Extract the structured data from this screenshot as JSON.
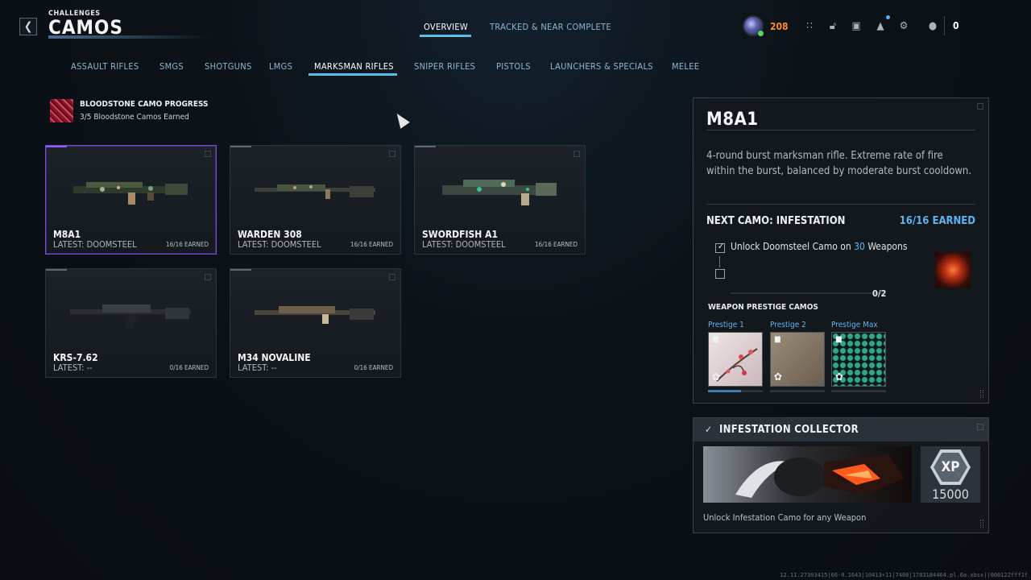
{
  "header": {
    "kicker": "CHALLENGES",
    "title": "CAMOS",
    "tabs": [
      {
        "label": "OVERVIEW",
        "active": true
      },
      {
        "label": "TRACKED & NEAR COMPLETE",
        "active": false
      }
    ],
    "status_count": "208",
    "currency": "0",
    "icons": [
      "back-icon",
      "grid-icon",
      "lock-icon",
      "camera-icon",
      "bell-icon",
      "gear-icon",
      "party-icon"
    ]
  },
  "categories": [
    {
      "label": "ASSAULT RIFLES"
    },
    {
      "label": "SMGS"
    },
    {
      "label": "SHOTGUNS"
    },
    {
      "label": "LMGS"
    },
    {
      "label": "MARKSMAN RIFLES",
      "active": true
    },
    {
      "label": "SNIPER RIFLES"
    },
    {
      "label": "PISTOLS"
    },
    {
      "label": "LAUNCHERS & SPECIALS"
    },
    {
      "label": "MELEE"
    }
  ],
  "progress": {
    "title": "BLOODSTONE CAMO PROGRESS",
    "subtitle": "3/5 Bloodstone Camos Earned"
  },
  "weapons": [
    {
      "name": "M8A1",
      "latest": "LATEST: DOOMSTEEL",
      "earned": "16/16 EARNED",
      "selected": true
    },
    {
      "name": "WARDEN 308",
      "latest": "LATEST: DOOMSTEEL",
      "earned": "16/16 EARNED"
    },
    {
      "name": "SWORDFISH A1",
      "latest": "LATEST: DOOMSTEEL",
      "earned": "16/16 EARNED"
    },
    {
      "name": "KRS-7.62",
      "latest": "LATEST: --",
      "earned": "0/16 EARNED"
    },
    {
      "name": "M34 NOVALINE",
      "latest": "LATEST: --",
      "earned": "0/16 EARNED"
    }
  ],
  "detail": {
    "title": "M8A1",
    "description": "4-round burst marksman rifle. Extreme rate of fire within the burst, balanced by moderate burst cooldown.",
    "next_camo": "NEXT CAMO: INFESTATION",
    "earned": "16/16 EARNED",
    "task_prefix": "Unlock Doomsteel Camo on ",
    "task_highlight": "30",
    "task_suffix": " Weapons",
    "task_count": "0/2",
    "prestige_heading": "WEAPON PRESTIGE CAMOS",
    "prestige": [
      {
        "label": "Prestige 1",
        "progress": 0.6
      },
      {
        "label": "Prestige 2",
        "progress": 0
      },
      {
        "label": "Prestige Max",
        "progress": 0
      }
    ]
  },
  "collector": {
    "title": "INFESTATION COLLECTOR",
    "xp_label": "XP",
    "xp_value": "15000",
    "description": "Unlock Infestation Camo for any Weapon"
  },
  "footer": {
    "build": "12.11.27303415|66-0.1643|10413+11|7400|1783184464.pl.6a.xbsx||000122fff1f"
  }
}
